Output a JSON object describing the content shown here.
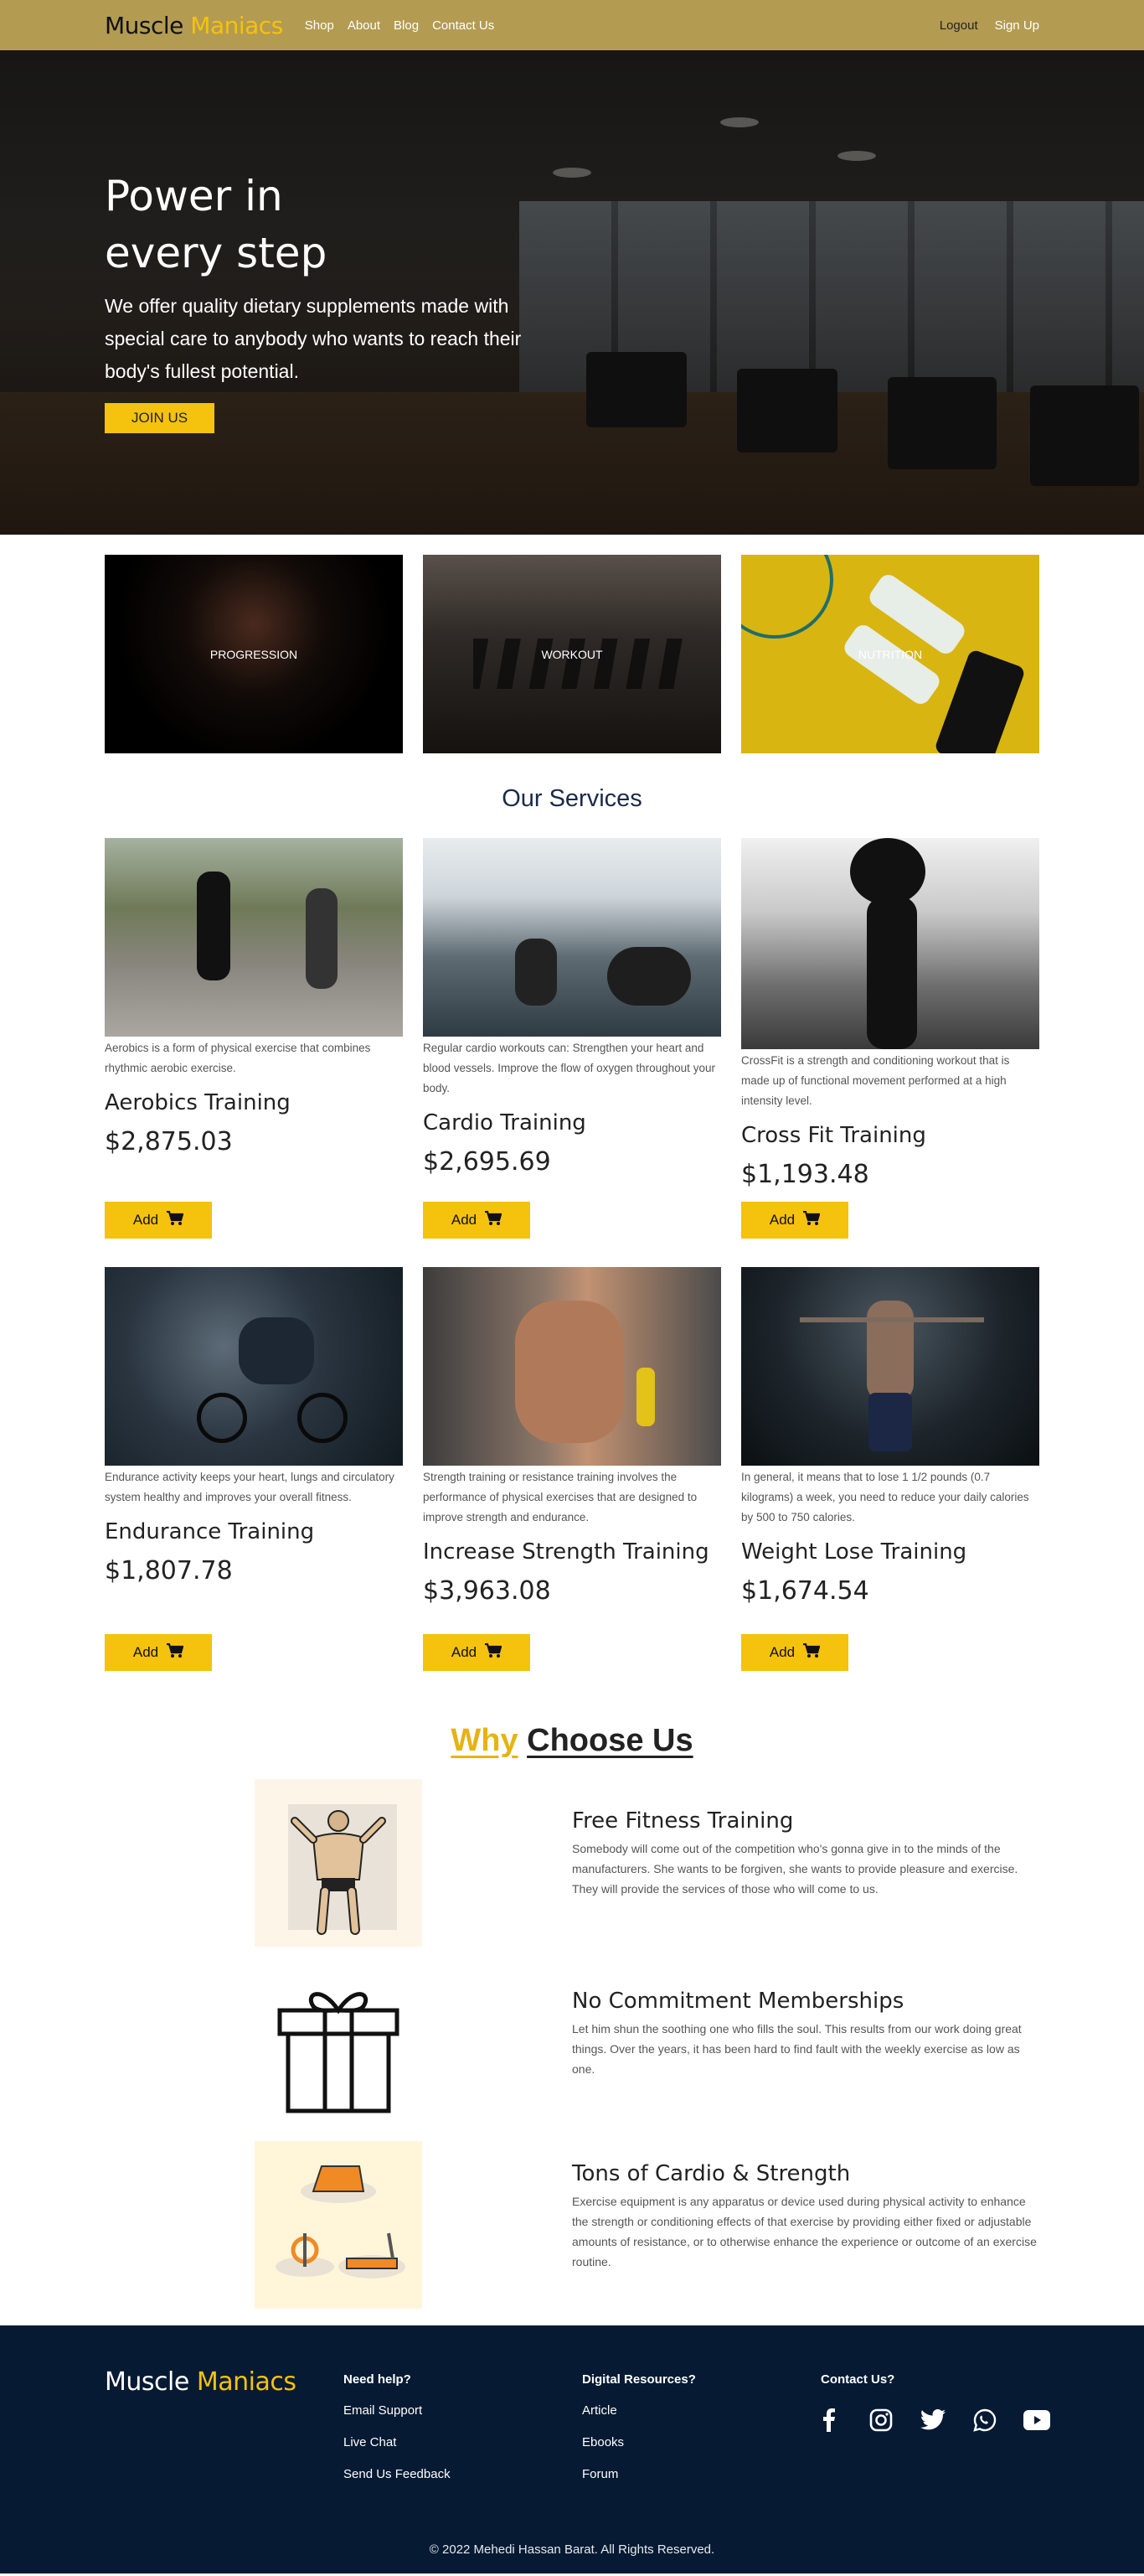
{
  "nav": {
    "brand_main": "Muscle ",
    "brand_accent": "Maniacs",
    "links": [
      "Shop",
      "About",
      "Blog",
      "Contact Us"
    ],
    "logout": "Logout",
    "signup": "Sign Up"
  },
  "hero": {
    "title": "Power in every step",
    "text": "We offer quality dietary supplements made with special care to anybody who wants to reach their body's fullest potential.",
    "button": "JOIN US"
  },
  "categories": [
    "PROGRESSION",
    "WORKOUT",
    "NUTRITION"
  ],
  "services": {
    "title": "Our Services",
    "add_label": "Add",
    "items": [
      {
        "desc": "Aerobics is a form of physical exercise that combines rhythmic aerobic exercise.",
        "name": "Aerobics Training",
        "price": "$2,875.03"
      },
      {
        "desc": "Regular cardio workouts can: Strengthen your heart and blood vessels. Improve the flow of oxygen throughout your body.",
        "name": "Cardio Training",
        "price": "$2,695.69"
      },
      {
        "desc": "CrossFit is a strength and conditioning workout that is made up of functional movement performed at a high intensity level.",
        "name": "Cross Fit Training",
        "price": "$1,193.48"
      },
      {
        "desc": "Endurance activity keeps your heart, lungs and circulatory system healthy and improves your overall fitness.",
        "name": "Endurance Training",
        "price": "$1,807.78"
      },
      {
        "desc": "Strength training or resistance training involves the performance of physical exercises that are designed to improve strength and endurance.",
        "name": "Increase Strength Training",
        "price": "$3,963.08"
      },
      {
        "desc": "In general, it means that to lose 1 1/2 pounds (0.7 kilograms) a week, you need to reduce your daily calories by 500 to 750 calories.",
        "name": "Weight Lose Training",
        "price": "$1,674.54"
      }
    ]
  },
  "why": {
    "title_accent": "Why",
    "title_rest": "Choose Us",
    "features": [
      {
        "title": "Free Fitness Training",
        "text": "Somebody will come out of the competition who's gonna give in to the minds of the manufacturers. She wants to be forgiven, she wants to provide pleasure and exercise. They will provide the services of those who will come to us."
      },
      {
        "title": "No Commitment Memberships",
        "text": "Let him shun the soothing one who fills the soul. This results from our work doing great things. Over the years, it has been hard to find fault with the weekly exercise as low as one."
      },
      {
        "title": "Tons of Cardio & Strength",
        "text": "Exercise equipment is any apparatus or device used during physical activity to enhance the strength or conditioning effects of that exercise by providing either fixed or adjustable amounts of resistance, or to otherwise enhance the experience or outcome of an exercise routine."
      }
    ]
  },
  "footer": {
    "brand_main": "Muscle ",
    "brand_accent": "Maniacs",
    "help": {
      "title": "Need help?",
      "links": [
        "Email Support",
        "Live Chat",
        "Send Us Feedback"
      ]
    },
    "resources": {
      "title": "Digital Resources?",
      "links": [
        "Article",
        "Ebooks",
        "Forum"
      ]
    },
    "contact": {
      "title": "Contact Us?",
      "icons": [
        "facebook-icon",
        "instagram-icon",
        "twitter-icon",
        "whatsapp-icon",
        "youtube-icon"
      ]
    },
    "copyright": "© 2022 Mehedi Hassan Barat. All Rights Reserved."
  },
  "colors": {
    "accent": "#f5c20d",
    "navbar": "#b39b52",
    "footer": "#061a33"
  }
}
